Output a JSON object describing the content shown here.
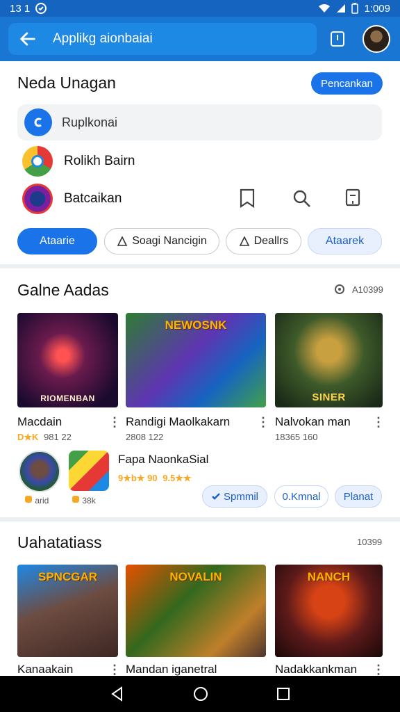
{
  "status_bar": {
    "time_left": "13 1",
    "time_right": "1:009"
  },
  "app_bar": {
    "search_text": "Applikg aionbaiai"
  },
  "section1": {
    "title": "Neda Unagan",
    "action_label": "Pencankan",
    "search_row_label": "Ruplkonai",
    "apps": [
      {
        "label": "Rolikh Bairn"
      },
      {
        "label": "Batcaikan"
      }
    ],
    "chips": [
      {
        "label": "Ataarie"
      },
      {
        "label": "Soagi Nancigin"
      },
      {
        "label": "Deallrs"
      },
      {
        "label": "Ataarek"
      }
    ]
  },
  "section2": {
    "title": "Galne Aadas",
    "count": "A10399",
    "games": [
      {
        "name": "Macdain",
        "rating": "D★K",
        "meta": "981 22",
        "caption": "RIOMENBAN"
      },
      {
        "name": "Randigi Maolkakarn",
        "meta": "2808 122",
        "banner": "NEWOSNK"
      },
      {
        "name": "Nalvokan man",
        "meta": "18365 160",
        "caption": "SINER"
      }
    ],
    "featured": {
      "name": "Fapa NaonkaSial",
      "rating": "9★b★ 90",
      "meta_suffix": "9.5★★",
      "badges": [
        {
          "label": "arid"
        },
        {
          "label": "38k"
        }
      ],
      "buttons": [
        {
          "label": "Spmmil"
        },
        {
          "label": "0.Kmnal"
        },
        {
          "label": "Planat"
        }
      ]
    }
  },
  "section3": {
    "title": "Uahatatiass",
    "count": "10399",
    "games": [
      {
        "name": "Kanaakain",
        "banner": "SPNCGAR"
      },
      {
        "name": "Mandan iganetral",
        "banner": "NOVALIN"
      },
      {
        "name": "Nadakkankman",
        "banner": "NANCH"
      }
    ]
  },
  "colors": {
    "primary": "#1976d2",
    "accent": "#1a73e8",
    "rating": "#f9a825"
  }
}
